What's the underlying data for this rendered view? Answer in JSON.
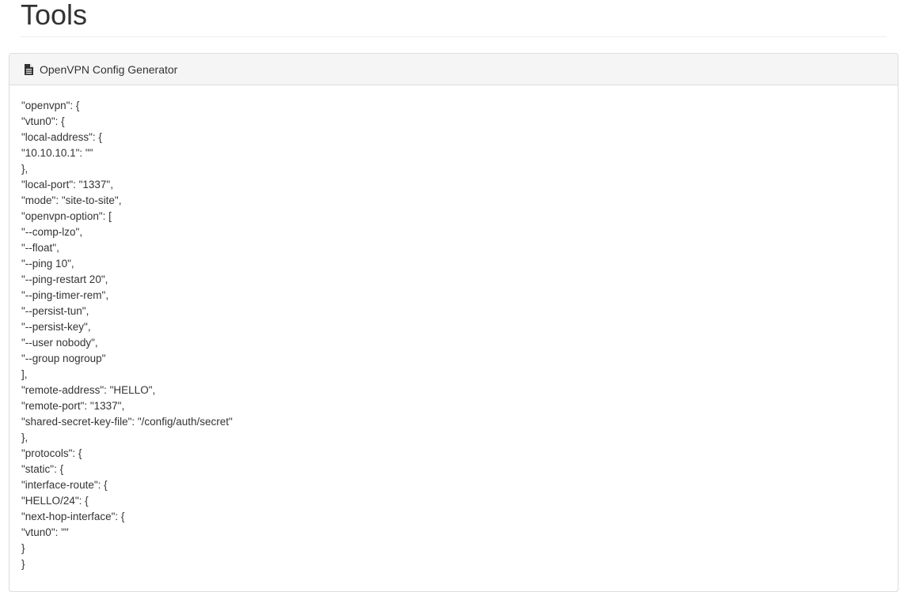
{
  "page": {
    "title": "Tools"
  },
  "panel": {
    "icon": "file-text-icon",
    "title": "OpenVPN Config Generator",
    "lines": [
      "\"openvpn\": {",
      "\"vtun0\": {",
      "\"local-address\": {",
      "\"10.10.10.1\": \"\"",
      "},",
      "\"local-port\": \"1337\",",
      "\"mode\": \"site-to-site\",",
      "\"openvpn-option\": [",
      "\"--comp-lzo\",",
      "\"--float\",",
      "\"--ping 10\",",
      "\"--ping-restart 20\",",
      "\"--ping-timer-rem\",",
      "\"--persist-tun\",",
      "\"--persist-key\",",
      "\"--user nobody\",",
      "\"--group nogroup\"",
      "],",
      "\"remote-address\": \"HELLO\",",
      "\"remote-port\": \"1337\",",
      "\"shared-secret-key-file\": \"/config/auth/secret\"",
      "},",
      "\"protocols\": {",
      "\"static\": {",
      "\"interface-route\": {",
      "\"HELLO/24\": {",
      "\"next-hop-interface\": {",
      "\"vtun0\": \"\"",
      "}",
      "}"
    ]
  }
}
